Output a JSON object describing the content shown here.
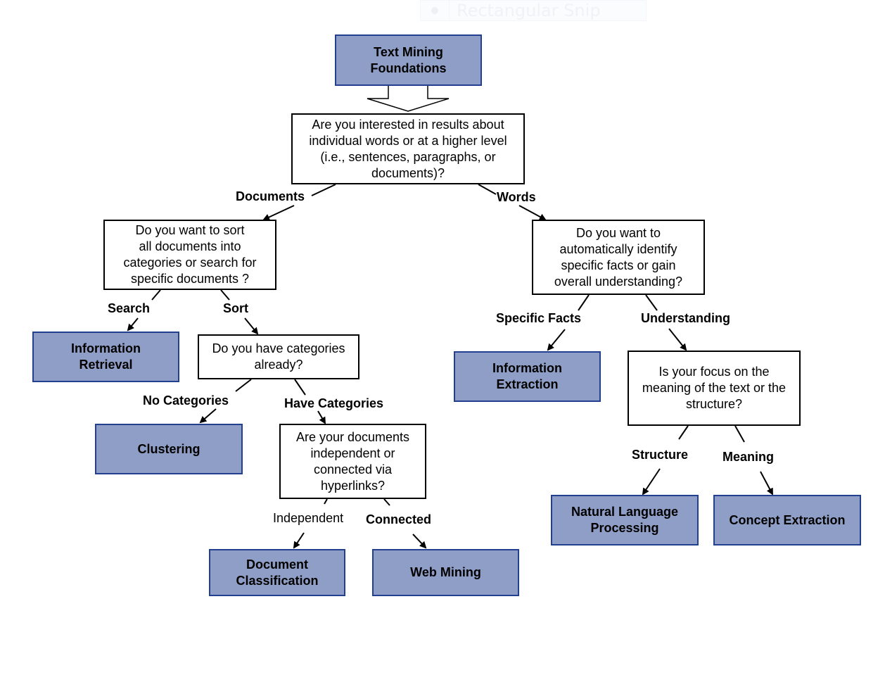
{
  "overlay": {
    "icon": "record-dot-icon",
    "label": "Rectangular Snip"
  },
  "diagram": {
    "root": "Text Mining\nFoundations",
    "questions": {
      "level": "Are you interested in results about\nindividual words or at a higher level\n(i.e., sentences, paragraphs, or\ndocuments)?",
      "sort_search": "Do you want to sort\nall documents into\ncategories or search for\nspecific documents ?",
      "have_categories": "Do you have categories\nalready?",
      "independent_connected": "Are your documents\nindependent or\nconnected via\nhyperlinks?",
      "facts_understanding": "Do you want to\nautomatically identify\nspecific facts or gain\noverall understanding?",
      "meaning_structure": "Is your focus on the\nmeaning of the text or the\nstructure?"
    },
    "outcomes": {
      "information_retrieval": "Information\nRetrieval",
      "clustering": "Clustering",
      "document_classification": "Document\nClassification",
      "web_mining": "Web Mining",
      "information_extraction": "Information\nExtraction",
      "nlp": "Natural Language\nProcessing",
      "concept_extraction": "Concept Extraction"
    },
    "edge_labels": {
      "documents": "Documents",
      "words": "Words",
      "search": "Search",
      "sort": "Sort",
      "no_categories": "No Categories",
      "have_categories": "Have Categories",
      "independent": "Independent",
      "connected": "Connected",
      "specific_facts": "Specific Facts",
      "understanding": "Understanding",
      "structure": "Structure",
      "meaning": "Meaning"
    },
    "colors": {
      "terminal_fill": "#8f9ec6",
      "terminal_border": "#233f8f",
      "question_border": "#000000"
    }
  }
}
